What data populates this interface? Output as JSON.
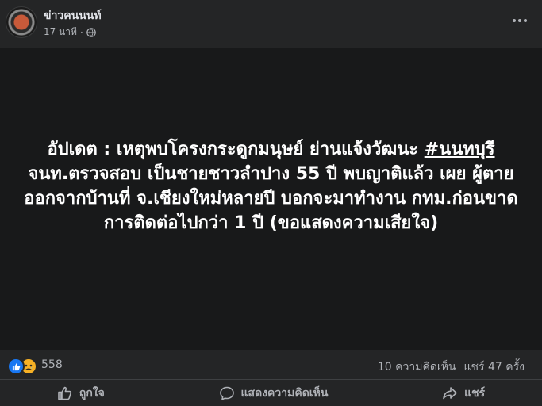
{
  "post": {
    "page_name": "ข่าวคนนนท์",
    "timestamp": "17 นาที",
    "separator": "·",
    "privacy_icon": "globe-icon",
    "more_icon": "more-options-icon"
  },
  "content": {
    "text_part1": "อัปเดต : เหตุพบโครงกระดูกมนุษย์ ย่านแจ้งวัฒนะ ",
    "hashtag": "#นนทบุรี",
    "text_part2": " จนท.ตรวจสอบ เป็นชายชาวลำปาง 55 ปี พบญาติแล้ว เผย ผู้ตายออกจากบ้านที่ จ.เชียงใหม่หลายปี บอกจะมาทำงาน กทม.ก่อนขาดการติดต่อไปกว่า 1 ปี (ขอแสดงความเสียใจ)"
  },
  "reactions": {
    "icons": [
      "like-icon",
      "sad-icon"
    ],
    "count": "558",
    "comments": "10 ความคิดเห็น",
    "shares": "แชร์ 47 ครั้ง"
  },
  "actions": {
    "like_label": "ถูกใจ",
    "comment_label": "แสดงความคิดเห็น",
    "share_label": "แชร์"
  },
  "colors": {
    "background": "#242526",
    "image_background": "#18191a",
    "text_primary": "#e4e6eb",
    "text_secondary": "#b0b3b8",
    "like_blue": "#1877f2",
    "sad_yellow": "#f7b125"
  }
}
